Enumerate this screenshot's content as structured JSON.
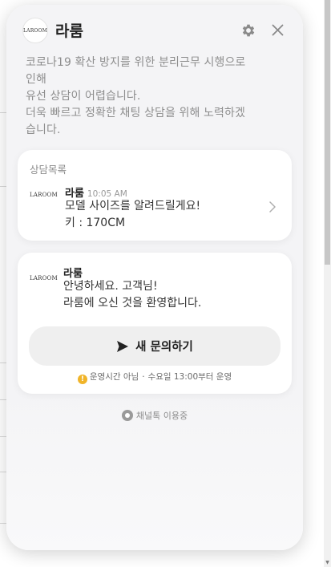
{
  "header": {
    "logo_text": "LAROOM",
    "title": "라룸"
  },
  "notice": {
    "lines": [
      "코로나19 확산 방지를 위한 분리근무 시행으로",
      "인해",
      "유선 상담이 어렵습니다.",
      "더욱 빠르고 정확한 채팅 상담을 위해 노력하겠",
      "습니다."
    ]
  },
  "history": {
    "section_title": "상담목록",
    "logo_text": "LAROOM",
    "sender": "라룸",
    "time": "10:05 AM",
    "message_lines": [
      "모델 사이즈를 알려드릴게요!",
      "키 : 170CM"
    ]
  },
  "welcome": {
    "logo_text": "LAROOM",
    "sender": "라룸",
    "message_lines": [
      "안녕하세요. 고객님!",
      "라룸에 오신 것을 환영합니다."
    ],
    "button_label": "새 문의하기",
    "hours_status": "운영시간 아님",
    "hours_separator": "·",
    "hours_info": "수요일 13:00부터 운영"
  },
  "footer": {
    "label": "채널톡 이용중"
  },
  "icons": {
    "gear": "gear-icon",
    "close": "close-icon",
    "chevron": "chevron-right-icon",
    "send": "send-icon",
    "warning": "warning-icon",
    "channeltalk": "channeltalk-icon"
  },
  "colors": {
    "widget_bg": "#f4f4f6",
    "card_bg": "#ffffff",
    "button_bg": "#efefef",
    "warning": "#f0b429",
    "muted_text": "#8e8e8e"
  }
}
